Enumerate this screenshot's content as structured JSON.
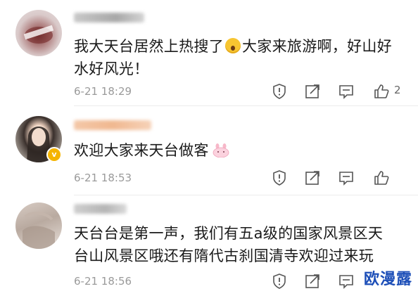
{
  "comments": [
    {
      "text_line1": "我大天台居然上热搜了",
      "text_line1b": "大家来旅游啊，好山好",
      "text_line2": "水好风光！",
      "time": "6-21 18:29",
      "likes": "2"
    },
    {
      "text_line1": "欢迎大家来天台做客",
      "time": "6-21 18:53",
      "likes": ""
    },
    {
      "text_line1": "天台台是第一声，我们有五a级的国家风景区天",
      "text_line2": "台山风景区哦还有隋代古刹国清寺欢迎过来玩",
      "time": "6-21 18:56",
      "likes": ""
    }
  ],
  "icons": {
    "report": "report-icon",
    "share": "share-icon",
    "reply": "reply-icon",
    "like": "like-icon"
  },
  "colors": {
    "watermark": "#1d4fb8",
    "time": "#9a9a9a",
    "vip_badge": "#f5b400"
  },
  "watermark": "欧漫露"
}
